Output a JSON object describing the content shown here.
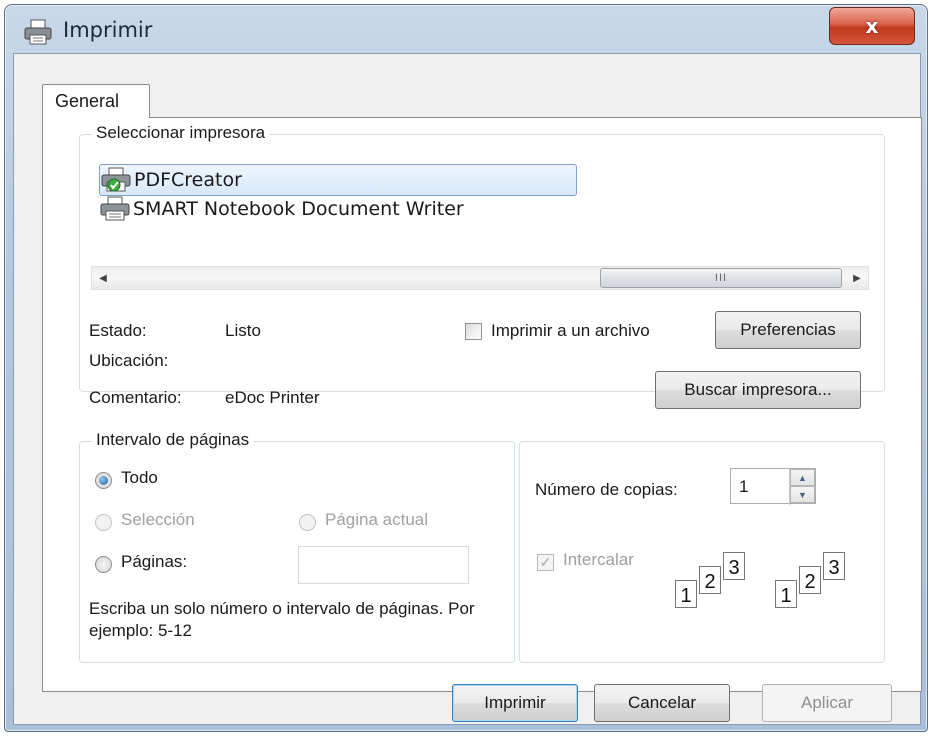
{
  "window": {
    "title": "Imprimir",
    "close_label": "x"
  },
  "tabs": [
    {
      "label": "General"
    }
  ],
  "printer_group": {
    "title": "Seleccionar impresora",
    "printers": [
      {
        "name": "PDFCreator",
        "selected": true
      },
      {
        "name": "SMART Notebook Document Writer",
        "selected": false
      }
    ],
    "scrollbar_grip": "III"
  },
  "status": {
    "estado_label": "Estado:",
    "estado_value": "Listo",
    "ubicacion_label": "Ubicación:",
    "ubicacion_value": "",
    "comentario_label": "Comentario:",
    "comentario_value": "eDoc Printer",
    "print_to_file_label": "Imprimir a un archivo",
    "print_to_file_checked": false,
    "preferences_button": "Preferencias",
    "find_printer_button": "Buscar impresora..."
  },
  "page_range": {
    "title": "Intervalo de páginas",
    "options": {
      "all": "Todo",
      "selection": "Selección",
      "current": "Página actual",
      "pages": "Páginas:"
    },
    "selected": "all",
    "pages_value": "",
    "hint": "Escriba un solo número o intervalo de páginas. Por ejemplo: 5-12"
  },
  "copies": {
    "label": "Número de copias:",
    "value": "1",
    "collate_label": "Intercalar",
    "collate_checked": true,
    "collate_pages": [
      "1",
      "2",
      "3"
    ]
  },
  "footer": {
    "print_button": "Imprimir",
    "cancel_button": "Cancelar",
    "apply_button": "Aplicar"
  }
}
